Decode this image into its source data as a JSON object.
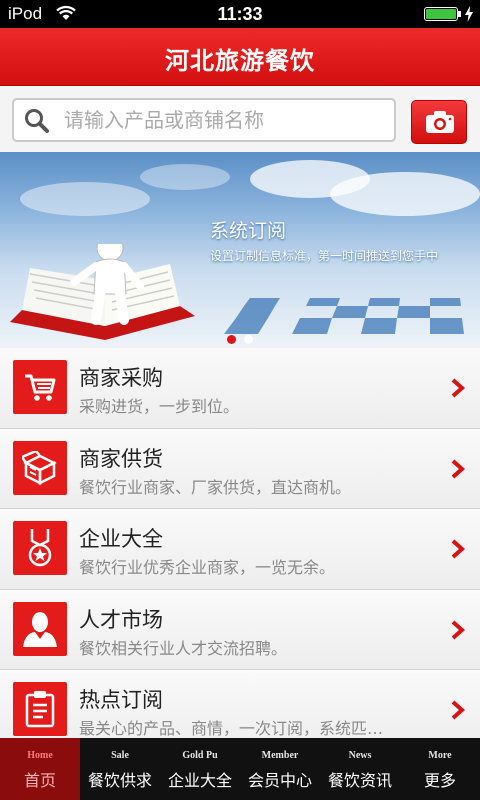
{
  "status_bar": {
    "carrier": "iPod",
    "time": "11:33"
  },
  "header": {
    "title": "河北旅游餐饮"
  },
  "search": {
    "placeholder": "请输入产品或商铺名称"
  },
  "banner": {
    "title": "系统订阅",
    "subtitle": "设置订制信息标准，第一时间推送到您手中"
  },
  "menu": [
    {
      "title": "商家采购",
      "desc": "采购进货，一步到位。",
      "icon": "cart-icon"
    },
    {
      "title": "商家供货",
      "desc": "餐饮行业商家、厂家供货，直达商机。",
      "icon": "box-icon"
    },
    {
      "title": "企业大全",
      "desc": "餐饮行业优秀企业商家，一览无余。",
      "icon": "medal-icon"
    },
    {
      "title": "人才市场",
      "desc": "餐饮相关行业人才交流招聘。",
      "icon": "person-icon"
    },
    {
      "title": "热点订阅",
      "desc": "最关心的产品、商情，一次订阅，系统匹…",
      "icon": "clipboard-icon"
    }
  ],
  "nav": [
    {
      "en": "Home",
      "cn": "首页"
    },
    {
      "en": "Sale",
      "cn": "餐饮供求"
    },
    {
      "en": "Gold Pu",
      "cn": "企业大全"
    },
    {
      "en": "Member",
      "cn": "会员中心"
    },
    {
      "en": "News",
      "cn": "餐饮资讯"
    },
    {
      "en": "More",
      "cn": "更多"
    }
  ],
  "colors": {
    "brand_red": "#e31b1b",
    "nav_bg": "#111111",
    "active_nav": "#8a0c0c"
  }
}
